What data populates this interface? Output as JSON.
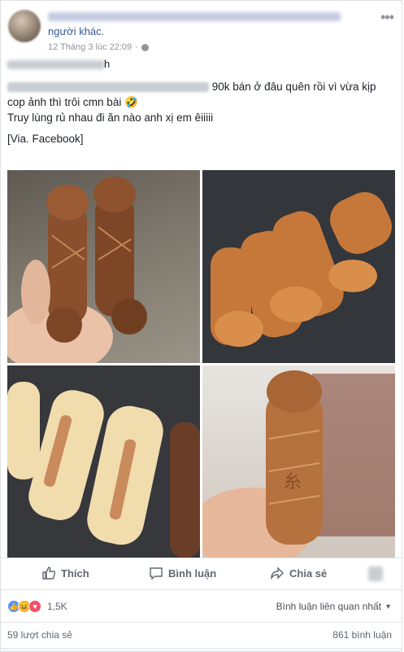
{
  "post": {
    "author_line_tail": "người khác.",
    "timestamp": "12 Tháng 3 lúc 22:09",
    "dot": "·",
    "text_line1_visible": "90k bán ở đâu quên rồi vì vừa kịp",
    "text_line2": "cop ảnh thì trôi cmn bài 🤣",
    "text_line3": "Truy lùng rủ nhau đi ăn nào anh xị em êiiiii",
    "text_line4": "[Via. Facebook]"
  },
  "actions": {
    "like_label": "Thích",
    "comment_label": "Bình luận",
    "share_label": "Chia sẻ"
  },
  "footer": {
    "reaction_count": "1,5K",
    "comment_filter": "Bình luận liên quan nhất",
    "shares": "59 lượt chia sẻ",
    "comments": "861 bình luận"
  },
  "colors": {
    "link": "#365899",
    "meta": "#90949c",
    "like_blue": "#5890ff",
    "love_red": "#f25268",
    "haha_yellow": "#f7b125"
  },
  "icons": [
    "more-icon",
    "globe-icon",
    "like-icon",
    "comment-icon",
    "share-icon",
    "chevron-down-icon"
  ]
}
